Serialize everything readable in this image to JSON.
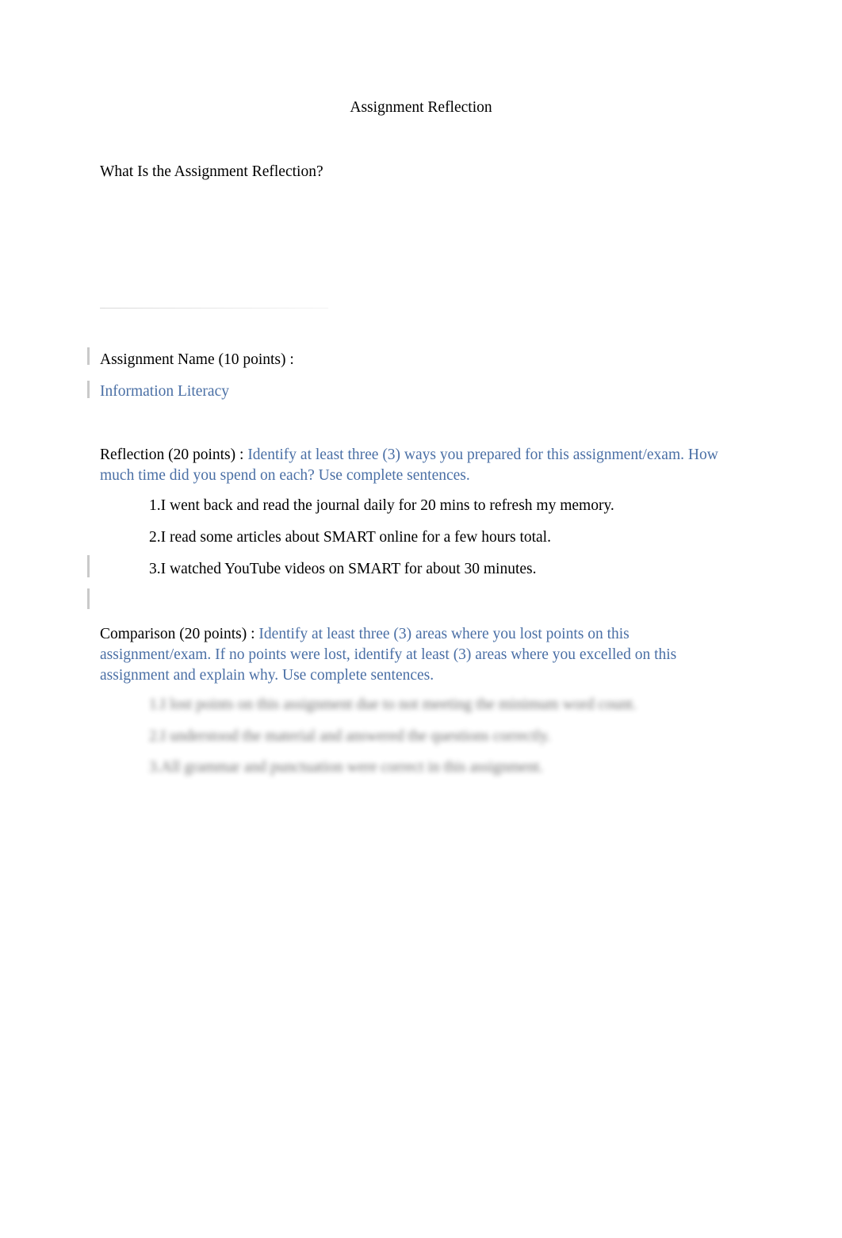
{
  "document": {
    "title": "Assignment Reflection",
    "heading": "What Is the Assignment Reflection?",
    "sections": {
      "assignment_name": {
        "label": "Assignment Name (10 points)  :",
        "answer": "Information Literacy"
      },
      "reflection": {
        "label": "Reflection (20 points) : ",
        "prompt": "Identify at least three (3) ways you prepared for this assignment/exam. How much time did you spend on each? Use complete sentences.",
        "items": [
          "1.I went back and read the journal daily for 20 mins to refresh my memory.",
          "2.I read some articles about SMART online for a few hours total.",
          "3.I watched YouTube videos on SMART for about 30 minutes."
        ]
      },
      "comparison": {
        "label": "Comparison (20 points)  : ",
        "prompt": "Identify at least three (3) areas where you lost points on this assignment/exam. If no points were lost, identify at least (3) areas where you excelled on this assignment and explain why. Use complete sentences.",
        "items": [
          "1.I lost points on this assignment due to not meeting the minimum word count.",
          "2.I understood the material and answered the questions correctly.",
          "3.All grammar and punctuation were correct in this assignment."
        ]
      }
    }
  }
}
